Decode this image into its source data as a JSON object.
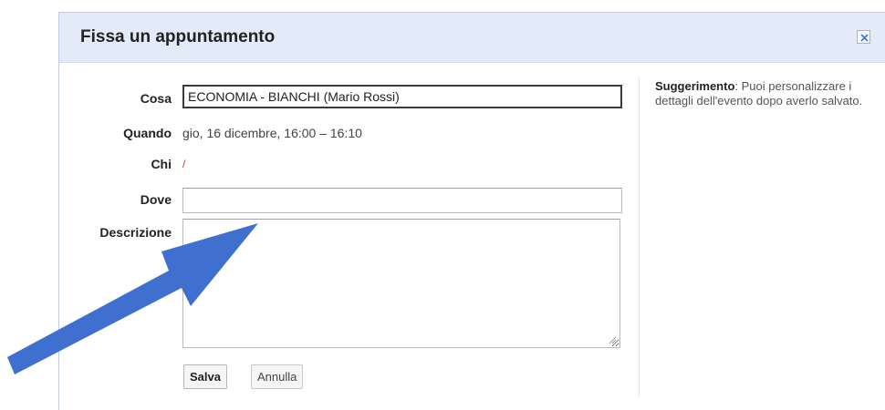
{
  "dialog": {
    "title": "Fissa un appuntamento",
    "close_icon": "close-icon"
  },
  "form": {
    "what_label": "Cosa",
    "what_value": "ECONOMIA - BIANCHI (Mario Rossi)",
    "when_label": "Quando",
    "when_value": "gio, 16 dicembre, 16:00 – 16:10",
    "who_label": "Chi",
    "who_value": "/",
    "where_label": "Dove",
    "where_value": "",
    "description_label": "Descrizione",
    "description_value": ""
  },
  "buttons": {
    "save_label": "Salva",
    "cancel_label": "Annulla"
  },
  "hint": {
    "title": "Suggerimento",
    "text": ": Puoi personalizzare i dettagli dell'evento dopo averlo salvato."
  },
  "colors": {
    "header_bg": "#e4ebf8",
    "arrow": "#3f6fcf"
  },
  "annotation_icon": "arrow-annotation-icon"
}
